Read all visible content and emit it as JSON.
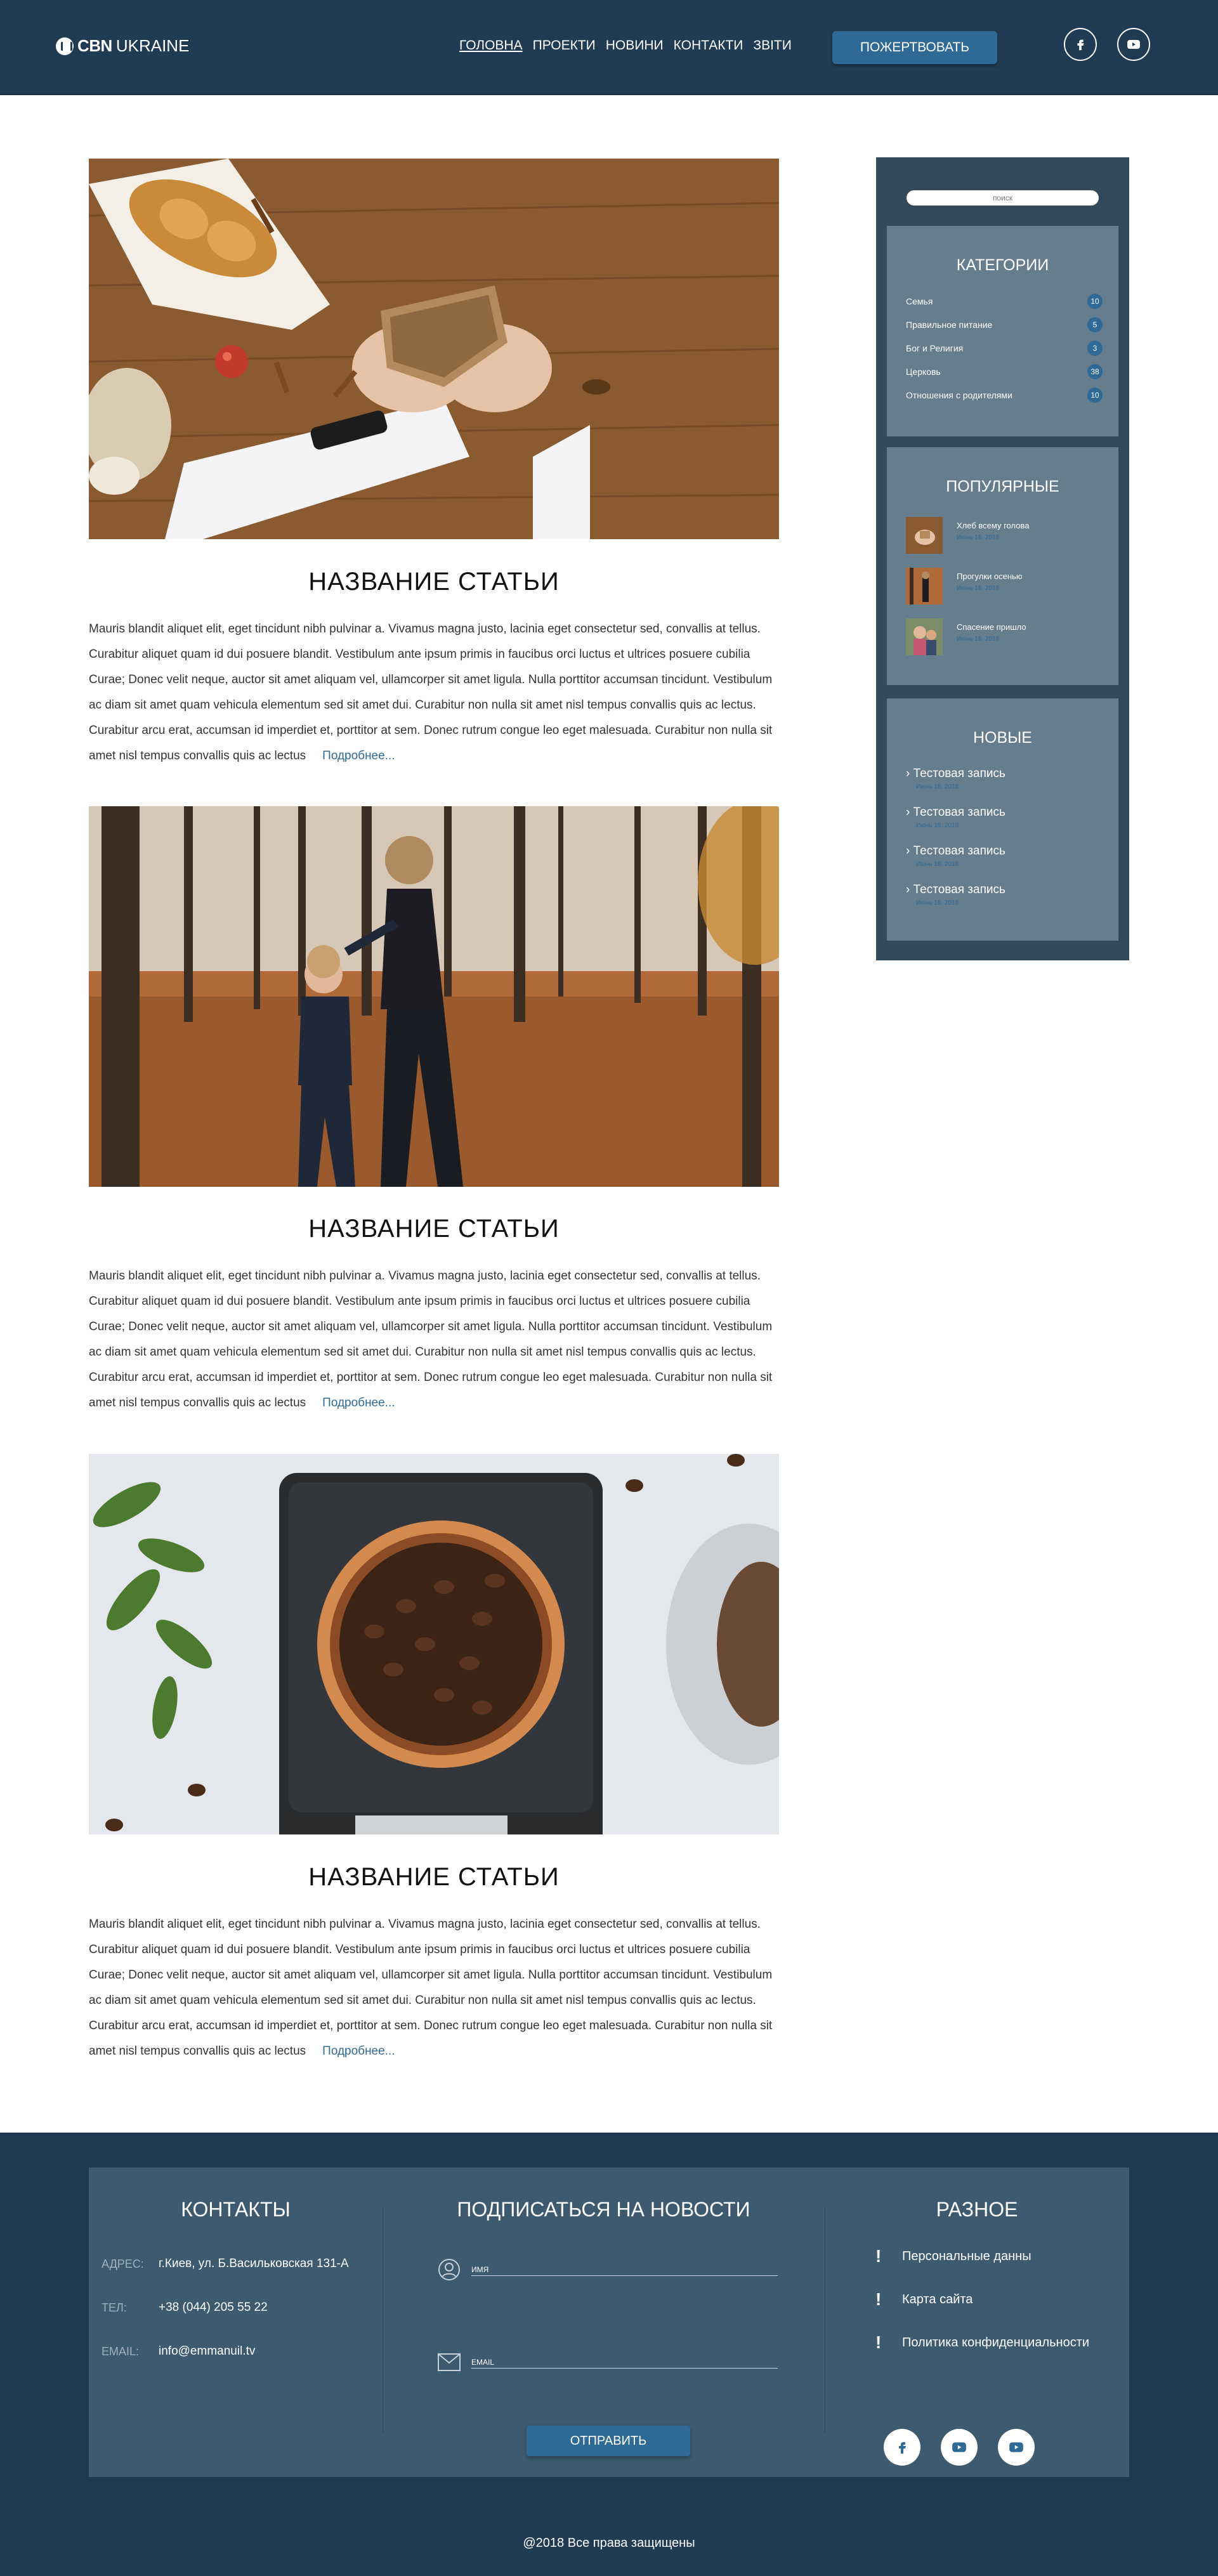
{
  "header": {
    "logo_mark": "CBN",
    "logo_rest": "UKRAINE",
    "nav": [
      {
        "label": "ГОЛОВНА",
        "active": true
      },
      {
        "label": "ПРОЕКТИ",
        "active": false
      },
      {
        "label": "НОВИНИ",
        "active": false
      },
      {
        "label": "КОНТАКТИ",
        "active": false
      },
      {
        "label": "ЗВІТИ",
        "active": false
      }
    ],
    "donate_label": "ПОЖЕРТВОВАТЬ",
    "social": [
      "facebook-icon",
      "youtube-icon"
    ]
  },
  "articles": [
    {
      "title": "НАЗВАНИЕ СТАТЬИ",
      "image": "bread-hands-photo",
      "body": "Mauris blandit aliquet elit, eget tincidunt nibh pulvinar a. Vivamus magna justo, lacinia eget consectetur sed, convallis at tellus. Curabitur aliquet quam id dui posuere blandit. Vestibulum ante ipsum primis in faucibus orci luctus et ultrices posuere cubilia Curae; Donec velit neque, auctor sit amet aliquam vel, ullamcorper sit amet ligula. Nulla porttitor accumsan tincidunt. Vestibulum ac diam sit amet quam vehicula elementum sed sit amet dui. Curabitur non nulla sit amet nisl tempus convallis quis ac lectus. Curabitur arcu erat, accumsan id imperdiet et, porttitor at sem. Donec rutrum congue leo eget malesuada. Curabitur non nulla sit amet nisl tempus convallis quis ac lectus",
      "more_label": "Подробнее..."
    },
    {
      "title": "НАЗВАНИЕ СТАТЬИ",
      "image": "mother-child-forest-photo",
      "body": "Mauris blandit aliquet elit, eget tincidunt nibh pulvinar a. Vivamus magna justo, lacinia eget consectetur sed, convallis at tellus. Curabitur aliquet quam id dui posuere blandit. Vestibulum ante ipsum primis in faucibus orci luctus et ultrices posuere cubilia Curae; Donec velit neque, auctor sit amet aliquam vel, ullamcorper sit amet ligula. Nulla porttitor accumsan tincidunt. Vestibulum ac diam sit amet quam vehicula elementum sed sit amet dui. Curabitur non nulla sit amet nisl tempus convallis quis ac lectus. Curabitur arcu erat, accumsan id imperdiet et, porttitor at sem. Donec rutrum congue leo eget malesuada. Curabitur non nulla sit amet nisl tempus convallis quis ac lectus",
      "more_label": "Подробнее..."
    },
    {
      "title": "НАЗВАНИЕ СТАТЬИ",
      "image": "coffee-beans-scale-photo",
      "body": "Mauris blandit aliquet elit, eget tincidunt nibh pulvinar a. Vivamus magna justo, lacinia eget consectetur sed, convallis at tellus. Curabitur aliquet quam id dui posuere blandit. Vestibulum ante ipsum primis in faucibus orci luctus et ultrices posuere cubilia Curae; Donec velit neque, auctor sit amet aliquam vel, ullamcorper sit amet ligula. Nulla porttitor accumsan tincidunt. Vestibulum ac diam sit amet quam vehicula elementum sed sit amet dui. Curabitur non nulla sit amet nisl tempus convallis quis ac lectus. Curabitur arcu erat, accumsan id imperdiet et, porttitor at sem. Donec rutrum congue leo eget malesuada. Curabitur non nulla sit amet nisl tempus convallis quis ac lectus",
      "more_label": "Подробнее..."
    }
  ],
  "sidebar": {
    "search_placeholder": "поиск",
    "categories": {
      "title": "КАТЕГОРИИ",
      "items": [
        {
          "label": "Семья",
          "count": "10"
        },
        {
          "label": "Правильное питание",
          "count": "5"
        },
        {
          "label": "Бог и Религия",
          "count": "3"
        },
        {
          "label": "Церковь",
          "count": "38"
        },
        {
          "label": "Отношения с родителями",
          "count": "10"
        }
      ]
    },
    "popular": {
      "title": "ПОПУЛЯРНЫЕ",
      "items": [
        {
          "title": "Хлеб всему голова",
          "date": "Июнь 18, 2018"
        },
        {
          "title": "Прогулки осенью",
          "date": "Июнь 18, 2018"
        },
        {
          "title": "Спасение пришло",
          "date": "Июнь 18, 2018"
        }
      ]
    },
    "new": {
      "title": "НОВЫЕ",
      "items": [
        {
          "title": "Тестовая запись",
          "date": "Июнь 18, 2018"
        },
        {
          "title": "Тестовая запись",
          "date": "Июнь 18, 2018"
        },
        {
          "title": "Тестовая запись",
          "date": "Июнь 18, 2018"
        },
        {
          "title": "Тестовая запись",
          "date": "Июнь 18, 2018"
        }
      ]
    }
  },
  "footer": {
    "contacts": {
      "title": "КОНТАКТЫ",
      "rows": [
        {
          "label": "АДРЕС:",
          "value": "г.Киев, ул. Б.Васильковская 131-А"
        },
        {
          "label": "ТЕЛ:",
          "value": "+38 (044) 205 55 22"
        },
        {
          "label": "EMAIL:",
          "value": "info@emmanuil.tv"
        }
      ]
    },
    "subscribe": {
      "title": "ПОДПИСАТЬСЯ НА НОВОСТИ",
      "name_placeholder": "ИМЯ",
      "email_placeholder": "EMAIL",
      "send_label": "ОТПРАВИТЬ"
    },
    "misc": {
      "title": "РАЗНОЕ",
      "links": [
        "Персональные данны",
        "Карта сайта",
        "Политика конфиденциальности"
      ]
    },
    "copyright": "@2018 Все права защищены"
  },
  "colors": {
    "header_bg": "#213c52",
    "accent": "#2f6a96",
    "sidebar_bg": "#334a5c",
    "panel_bg": "#667d8e",
    "footer_bg": "#1f3a50",
    "footer_panel": "#3e5a6f"
  }
}
